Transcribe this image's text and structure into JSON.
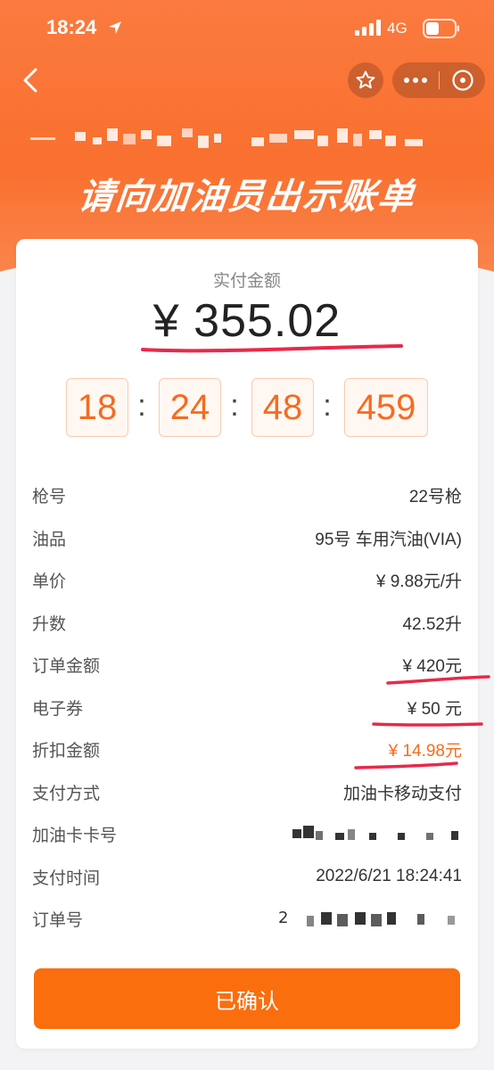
{
  "status_bar": {
    "time": "18:24",
    "network": "4G"
  },
  "header": {
    "headline": "请向加油员出示账单"
  },
  "payment": {
    "amount_label": "实付金额",
    "amount_value": "¥ 355.02"
  },
  "timer": {
    "hours": "18",
    "minutes": "24",
    "seconds": "48",
    "millis": "459",
    "separator": ":"
  },
  "details": [
    {
      "label": "枪号",
      "value": "22号枪"
    },
    {
      "label": "油品",
      "value": "95号 车用汽油(VIA)"
    },
    {
      "label": "单价",
      "value": "¥ 9.88元/升"
    },
    {
      "label": "升数",
      "value": "42.52升"
    },
    {
      "label": "订单金额",
      "value": "¥ 420元"
    },
    {
      "label": "电子券",
      "value": "¥ 50 元"
    },
    {
      "label": "折扣金额",
      "value": "¥ 14.98元"
    },
    {
      "label": "支付方式",
      "value": "加油卡移动支付"
    },
    {
      "label": "加油卡卡号",
      "value": ""
    },
    {
      "label": "支付时间",
      "value": "2022/6/21 18:24:41"
    },
    {
      "label": "订单号",
      "value": "2"
    }
  ],
  "actions": {
    "confirm_label": "已确认"
  },
  "colors": {
    "brand_orange": "#fa6e0e",
    "accent_text": "#f46c1f",
    "annotation_red": "#e8294a"
  }
}
